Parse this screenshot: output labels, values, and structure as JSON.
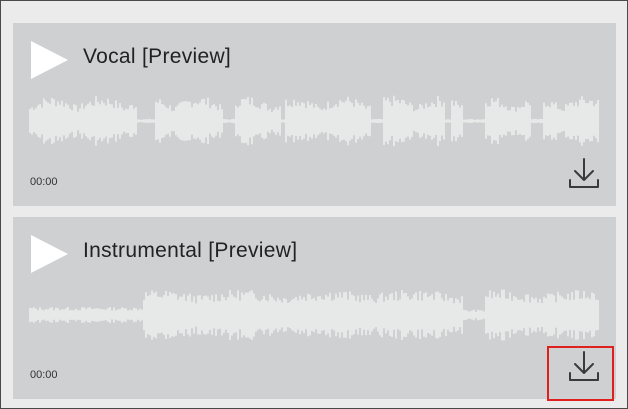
{
  "tracks": [
    {
      "title": "Vocal [Preview]",
      "time": "00:00",
      "play_icon": "play-icon",
      "download_icon": "download-icon"
    },
    {
      "title": "Instrumental [Preview]",
      "time": "00:00",
      "play_icon": "play-icon",
      "download_icon": "download-icon",
      "download_highlighted": true
    }
  ],
  "colors": {
    "panel_background": "#cfd0d1",
    "frame_background": "#ebebeb",
    "waveform": "#ffffff",
    "highlight": "#e0201f"
  }
}
